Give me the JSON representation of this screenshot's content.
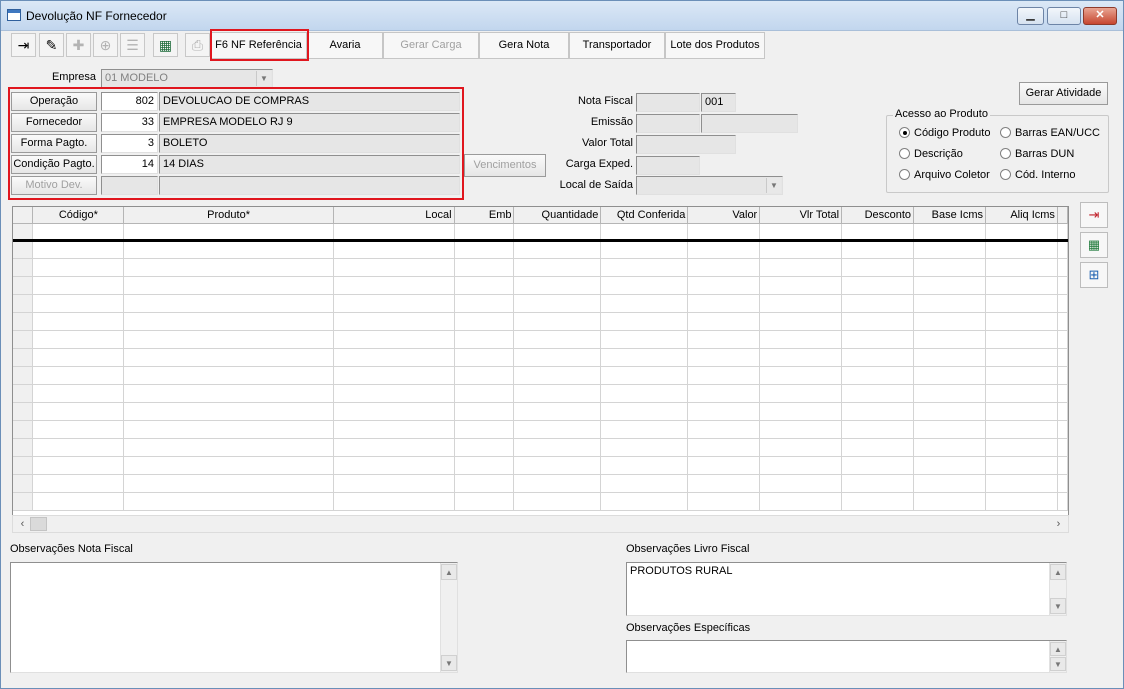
{
  "window": {
    "title": "Devolução NF Fornecedor"
  },
  "toolbar": {
    "icons": [
      "exit-icon",
      "eraser-icon",
      "add-icon",
      "add-item-icon",
      "remove-icon",
      "spreadsheet-icon",
      "print-icon"
    ],
    "buttons": [
      "F6 NF Referência",
      "Avaria",
      "Gerar Carga",
      "Gera Nota",
      "Transportador",
      "Lote dos Produtos"
    ]
  },
  "form": {
    "empresa_label": "Empresa",
    "empresa_value": "01 MODELO",
    "operacao_label": "Operação",
    "operacao_code": "802",
    "operacao_desc": "DEVOLUCAO DE COMPRAS",
    "fornecedor_label": "Fornecedor",
    "fornecedor_code": "33",
    "fornecedor_desc": "EMPRESA MODELO RJ 9",
    "forma_label": "Forma Pagto.",
    "forma_code": "3",
    "forma_desc": "BOLETO",
    "condicao_label": "Condição Pagto.",
    "condicao_code": "14",
    "condicao_desc": "14 DIAS",
    "motivo_label": "Motivo Dev.",
    "vencimentos_label": "Vencimentos",
    "nota_fiscal_label": "Nota Fiscal",
    "nota_fiscal_serie": "001",
    "emissao_label": "Emissão",
    "valor_total_label": "Valor Total",
    "carga_label": "Carga Exped.",
    "local_saida_label": "Local de Saída",
    "gerar_atividade_label": "Gerar Atividade"
  },
  "acesso": {
    "title": "Acesso ao Produto",
    "options": [
      "Código Produto",
      "Barras EAN/UCC",
      "Descrição",
      "Barras DUN",
      "Arquivo Coletor",
      "Cód. Interno"
    ],
    "selected": "Código Produto"
  },
  "grid": {
    "columns": [
      "Código*",
      "Produto*",
      "Local",
      "Emb",
      "Quantidade",
      "Qtd Conferida",
      "Valor",
      "Vlr Total",
      "Desconto",
      "Base Icms",
      "Aliq Icms"
    ]
  },
  "side_icons": [
    "export-icon",
    "grid-add-icon",
    "insert-row-icon"
  ],
  "obs": {
    "nota_fiscal_label": "Observações Nota Fiscal",
    "nota_fiscal_text": "",
    "livro_label": "Observações Livro Fiscal",
    "livro_text": "PRODUTOS RURAL",
    "especificas_label": "Observações Específicas",
    "especificas_text": ""
  }
}
